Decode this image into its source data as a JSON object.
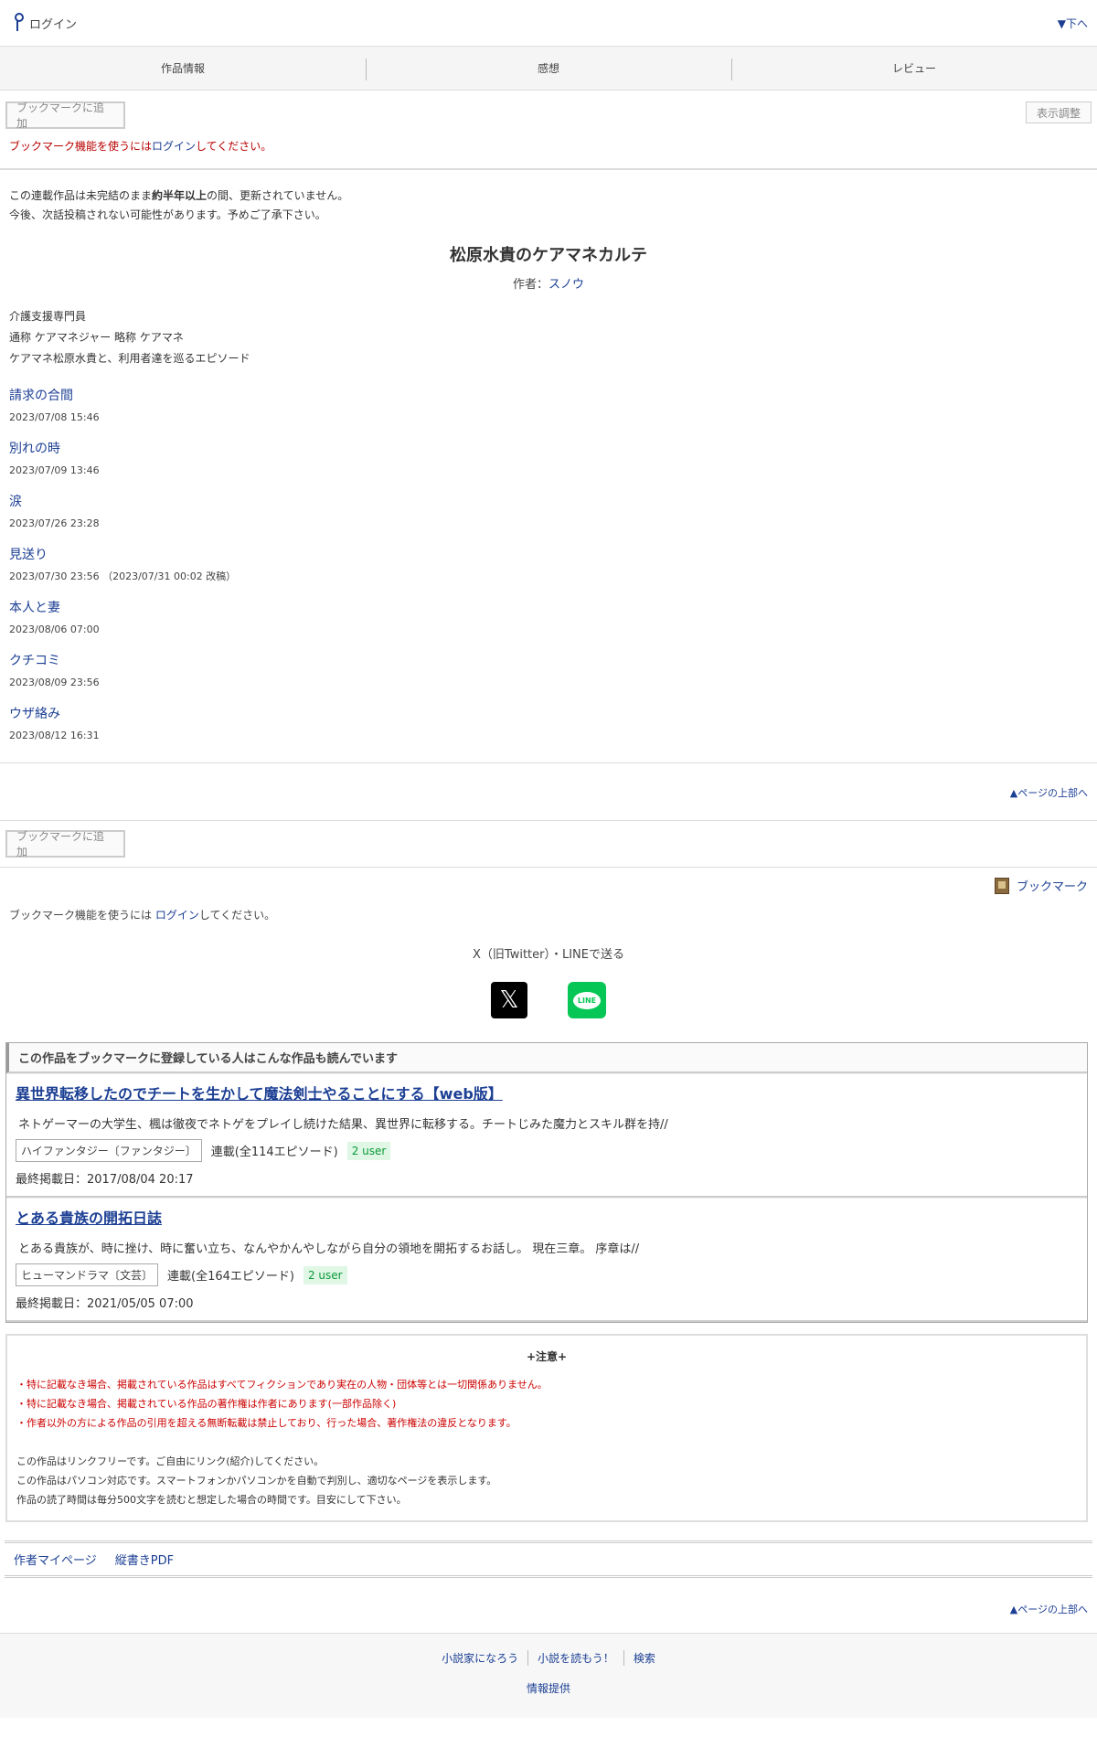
{
  "header": {
    "login_label": "ログイン",
    "to_bottom": "▼下へ"
  },
  "tabs": [
    "作品情報",
    "感想",
    "レビュー"
  ],
  "bookmark_button": "ブックマークに追加",
  "display_adjust": "表示調整",
  "bookmark_notice": {
    "prefix": "ブックマーク機能を使うには",
    "login": "ログイン",
    "suffix": "してください。"
  },
  "warning": {
    "line1_a": "この連載作品は未完結のまま",
    "line1_bold": "約半年以上",
    "line1_b": "の間、更新されていません。",
    "line2": "今後、次話投稿されない可能性があります。予めご了承下さい。"
  },
  "novel": {
    "title": "松原水貴のケアマネカルテ",
    "author_label": "作者：",
    "author": "スノウ",
    "synopsis": [
      "介護支援専門員",
      "通称 ケアマネジャー 略称 ケアマネ",
      "ケアマネ松原水貴と、利用者達を巡るエピソード"
    ]
  },
  "episodes": [
    {
      "title": "請求の合間",
      "date": "2023/07/08 15:46"
    },
    {
      "title": "別れの時",
      "date": "2023/07/09 13:46"
    },
    {
      "title": "涙",
      "date": "2023/07/26 23:28"
    },
    {
      "title": "見送り",
      "date": "2023/07/30 23:56 （2023/07/31 00:02 改稿）"
    },
    {
      "title": "本人と妻",
      "date": "2023/08/06 07:00"
    },
    {
      "title": "クチコミ",
      "date": "2023/08/09 23:56"
    },
    {
      "title": "ウザ絡み",
      "date": "2023/08/12 16:31"
    }
  ],
  "page_top": "▲ページの上部へ",
  "bookmark_link": "ブックマーク",
  "bookmark_text": {
    "prefix": "ブックマーク機能を使うには ",
    "login": "ログイン",
    "suffix": "してください。"
  },
  "share": {
    "title": "X（旧Twitter）・LINEで送る",
    "x_icon": "𝕏",
    "line_icon": "LINE"
  },
  "recommend": {
    "heading": "この作品をブックマークに登録している人はこんな作品も読んでいます",
    "items": [
      {
        "title": "異世界転移したのでチートを生かして魔法剣士やることにする【web版】",
        "desc": "ネトゲーマーの大学生、楓は徹夜でネトゲをプレイし続けた結果、異世界に転移する。チートじみた魔力とスキル群を持//",
        "genre": "ハイファンタジー〔ファンタジー〕",
        "serial": "連載(全114エピソード)",
        "users": "2 user",
        "last": "最終掲載日：2017/08/04 20:17"
      },
      {
        "title": "とある貴族の開拓日誌",
        "desc": "とある貴族が、時に挫け、時に奮い立ち、なんやかんやしながら自分の領地を開拓するお話し。 現在三章。 序章は//",
        "genre": "ヒューマンドラマ〔文芸〕",
        "serial": "連載(全164エピソード)",
        "users": "2 user",
        "last": "最終掲載日：2021/05/05 07:00"
      }
    ]
  },
  "caution": {
    "title": "+注意+",
    "red": [
      "・特に記載なき場合、掲載されている作品はすべてフィクションであり実在の人物・団体等とは一切関係ありません。",
      "・特に記載なき場合、掲載されている作品の著作権は作者にあります(一部作品除く)",
      "・作者以外の方による作品の引用を超える無断転載は禁止しており、行った場合、著作権法の違反となります。"
    ],
    "black": [
      "この作品はリンクフリーです。ご自由にリンク(紹介)してください。",
      "この作品はパソコン対応です。スマートフォンかパソコンかを自動で判別し、適切なページを表示します。",
      "作品の読了時間は毎分500文字を読むと想定した場合の時間です。目安にして下さい。"
    ]
  },
  "footlinks": [
    "作者マイページ",
    "縦書きPDF"
  ],
  "footer": {
    "links": [
      "小説家になろう",
      "小説を読もう！",
      "検索"
    ],
    "info": "情報提供"
  }
}
